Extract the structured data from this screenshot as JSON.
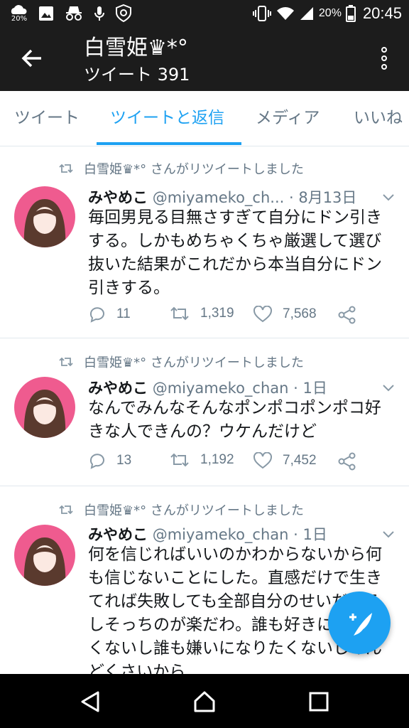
{
  "status_bar": {
    "weather_badge": "20%",
    "battery": "20%",
    "time": "20:45"
  },
  "header": {
    "title": "白雪姫♛*°",
    "subtitle": "ツイート 391"
  },
  "tabs": [
    {
      "label": "ツイート",
      "active": false
    },
    {
      "label": "ツイートと返信",
      "active": true
    },
    {
      "label": "メディア",
      "active": false
    },
    {
      "label": "いいね",
      "active": false
    }
  ],
  "tweets": [
    {
      "retweet_by": "白雪姫♛*° さんがリツイートしました",
      "name": "みやめこ",
      "handle": "@miyameko_ch...",
      "date": "· 8月13日",
      "lines": [
        "毎回男見る目無さすぎて自分にドン引き",
        "する。しかもめちゃくちゃ厳選して選び",
        "抜いた結果がこれだから本当自分にドン",
        "引きする。"
      ],
      "replies": "11",
      "retweets": "1,319",
      "likes": "7,568"
    },
    {
      "retweet_by": "白雪姫♛*° さんがリツイートしました",
      "name": "みやめこ",
      "handle": "@miyameko_chan",
      "date": "· 1日",
      "lines": [
        "なんでみんなそんなポンポコポンポコ好",
        "きな人できんの？ウケんだけど"
      ],
      "replies": "13",
      "retweets": "1,192",
      "likes": "7,452"
    },
    {
      "retweet_by": "白雪姫♛*° さんがリツイートしました",
      "name": "みやめこ",
      "handle": "@miyameko_chan",
      "date": "· 1日",
      "lines": [
        "何を信じればいいのかわからないから何",
        "も信じないことにした。直感だけで生き",
        "てれば失敗しても全部自分のせいだしろ",
        "しそっちのが楽だわ。誰も好きになりた",
        "くないし誰も嫌いになりたくないしめん",
        "どくさいから"
      ]
    }
  ],
  "colors": {
    "bar_bg": "#1c1c1c",
    "accent": "#1da1f2",
    "muted": "#657786",
    "avatar_bg": "#ef5b8f"
  }
}
